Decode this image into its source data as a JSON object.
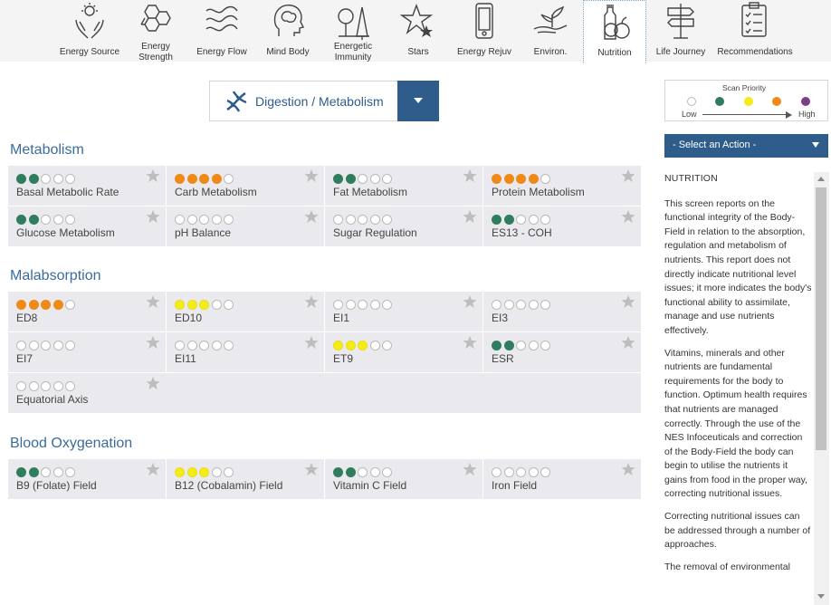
{
  "nav": {
    "items": [
      {
        "label": "Energy Source",
        "icon": "hands-sun-icon"
      },
      {
        "label": "Energy Strength",
        "icon": "hexagons-icon"
      },
      {
        "label": "Energy Flow",
        "icon": "waves-icon"
      },
      {
        "label": "Mind Body",
        "icon": "brain-head-icon"
      },
      {
        "label": "Energetic Immunity",
        "icon": "tree-icon"
      },
      {
        "label": "Stars",
        "icon": "stars-icon"
      },
      {
        "label": "Energy Rejuv",
        "icon": "phone-icon"
      },
      {
        "label": "Environ.",
        "icon": "hand-plant-icon"
      },
      {
        "label": "Nutrition",
        "icon": "bottle-fruit-icon",
        "active": true
      },
      {
        "label": "Life Journey",
        "icon": "signpost-icon"
      },
      {
        "label": "Recommendations",
        "icon": "checklist-icon"
      }
    ]
  },
  "category": {
    "label": "Digestion / Metabolism",
    "icon": "dna-icon"
  },
  "colors": {
    "green": "#2f7d5f",
    "orange": "#ef8a17",
    "yellow": "#f4ec18",
    "purple": "#7b3f88",
    "accent": "#2e5d8c",
    "title": "#3a6c9c"
  },
  "sections": [
    {
      "title": "Metabolism",
      "items": [
        {
          "name": "Basal Metabolic Rate",
          "level": "g",
          "count": 2
        },
        {
          "name": "Carb Metabolism",
          "level": "o",
          "count": 4
        },
        {
          "name": "Fat Metabolism",
          "level": "g",
          "count": 2
        },
        {
          "name": "Protein Metabolism",
          "level": "o",
          "count": 4
        },
        {
          "name": "Glucose Metabolism",
          "level": "g",
          "count": 2
        },
        {
          "name": "pH Balance",
          "level": "",
          "count": 0
        },
        {
          "name": "Sugar Regulation",
          "level": "",
          "count": 0
        },
        {
          "name": "ES13 - COH",
          "level": "g",
          "count": 2
        }
      ]
    },
    {
      "title": "Malabsorption",
      "items": [
        {
          "name": "ED8",
          "level": "o",
          "count": 4
        },
        {
          "name": "ED10",
          "level": "y",
          "count": 3
        },
        {
          "name": "EI1",
          "level": "",
          "count": 0
        },
        {
          "name": "EI3",
          "level": "",
          "count": 0
        },
        {
          "name": "EI7",
          "level": "",
          "count": 0
        },
        {
          "name": "EI11",
          "level": "",
          "count": 0
        },
        {
          "name": "ET9",
          "level": "y",
          "count": 3
        },
        {
          "name": "ESR",
          "level": "g",
          "count": 2
        },
        {
          "name": "Equatorial Axis",
          "level": "",
          "count": 0
        }
      ]
    },
    {
      "title": "Blood Oxygenation",
      "items": [
        {
          "name": "B9 (Folate) Field",
          "level": "g",
          "count": 2
        },
        {
          "name": "B12 (Cobalamin) Field",
          "level": "y",
          "count": 3
        },
        {
          "name": "Vitamin C Field",
          "level": "g",
          "count": 2
        },
        {
          "name": "Iron Field",
          "level": "",
          "count": 0
        }
      ]
    }
  ],
  "legend": {
    "title": "Scan Priority",
    "low": "Low",
    "high": "High"
  },
  "action": {
    "label": "- Select an Action -"
  },
  "notes": {
    "heading": "NUTRITION",
    "paragraphs": [
      "This screen reports on the functional integrity of the Body-Field in relation to the absorption, regulation and metabolism of nutrients. This report does not directly indicate nutritional level issues; it more indicates the body's functional ability to assimilate, manage and use nutrients effectively.",
      "Vitamins, minerals and other nutrients are fundamental requirements for the body to function. Optimum health requires that nutrients are managed correctly. Through the use of the NES Infoceuticals and correction of the Body-Field the body can begin to utilise the nutrients it gains from food in the proper way, correcting nutritional issues.",
      "Correcting nutritional issues can be addressed through a number of approaches.",
      "The removal of environmental"
    ]
  }
}
